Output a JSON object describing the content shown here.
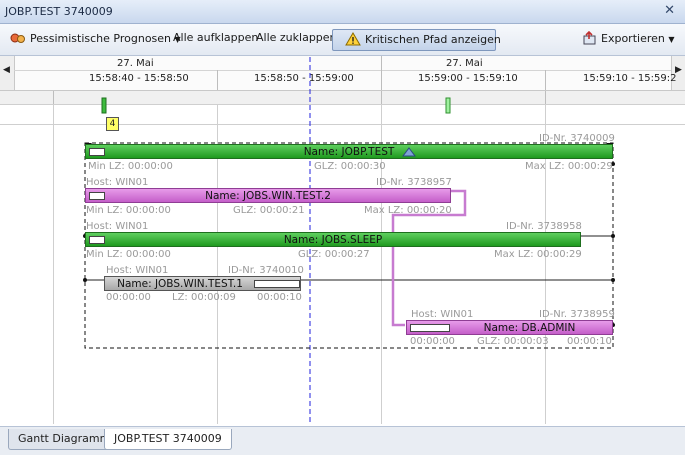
{
  "window": {
    "title": "JOBP.TEST 3740009"
  },
  "toolbar": {
    "pessimistic": "Pessimistische Prognosen",
    "expand_all": "Alle aufklappen",
    "collapse_all": "Alle zuklappen",
    "critical_path": "Kritischen Pfad anzeigen",
    "export": "Exportieren"
  },
  "timeline": {
    "dates": [
      "27. Mai",
      "27. Mai"
    ],
    "ranges": [
      "15:58:40 - 15:58:50",
      "15:58:50 - 15:59:00",
      "15:59:00 - 15:59:10",
      "15:59:10 - 15:59:2"
    ]
  },
  "marker_label": "4",
  "jobs": {
    "jobp": {
      "id": "ID-Nr. 3740009",
      "name": "Name: JOBP.TEST",
      "min": "Min LZ: 00:00:00",
      "glz": "GLZ: 00:00:30",
      "max": "Max LZ: 00:00:29"
    },
    "win2": {
      "host": "Host: WIN01",
      "id": "ID-Nr. 3738957",
      "name": "Name: JOBS.WIN.TEST.2",
      "min": "Min LZ: 00:00:00",
      "glz": "GLZ: 00:00:21",
      "max": "Max LZ: 00:00:20"
    },
    "sleep": {
      "host": "Host: WIN01",
      "id": "ID-Nr. 3738958",
      "name": "Name: JOBS.SLEEP",
      "min": "Min LZ: 00:00:00",
      "glz": "GLZ: 00:00:27",
      "max": "Max LZ: 00:00:29"
    },
    "win1": {
      "host": "Host: WIN01",
      "id": "ID-Nr. 3740010",
      "name": "Name: JOBS.WIN.TEST.1",
      "min": "00:00:00",
      "glz": "LZ: 00:00:09",
      "max": "00:00:10"
    },
    "admin": {
      "host": "Host: WIN01",
      "id": "ID-Nr. 3738959",
      "name": "Name: DB.ADMIN",
      "min": "00:00:00",
      "glz": "GLZ: 00:00:03",
      "max": "00:00:10"
    }
  },
  "tabs": [
    "Gantt Diagramm",
    "JOBP.TEST 3740009"
  ],
  "colors": {
    "green_bar": "#2fae2f",
    "purple_bar": "#d27bd6",
    "gray_bar": "#bdbdbd",
    "critical_line": "#c77bd0"
  }
}
